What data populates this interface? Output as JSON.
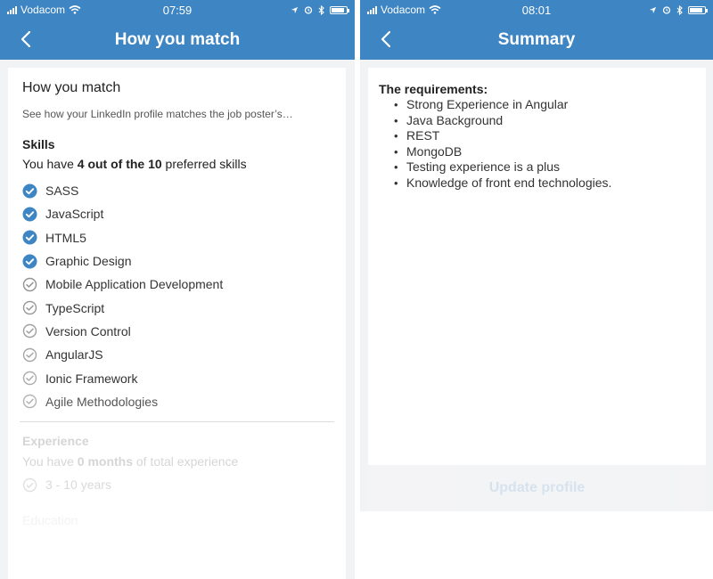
{
  "status_left": {
    "carrier": "Vodacom",
    "time": "07:59"
  },
  "status_right": {
    "carrier": "Vodacom",
    "time": "08:01"
  },
  "match_screen": {
    "title": "How you match",
    "card_title": "How you match",
    "card_subtitle": "See how your LinkedIn profile matches the job poster’s…",
    "skills": {
      "heading": "Skills",
      "summary_prefix": "You have ",
      "summary_bold": "4 out of the 10",
      "summary_suffix": " preferred skills",
      "items": [
        {
          "label": "SASS",
          "matched": true
        },
        {
          "label": "JavaScript",
          "matched": true
        },
        {
          "label": "HTML5",
          "matched": true
        },
        {
          "label": "Graphic Design",
          "matched": true
        },
        {
          "label": "Mobile Application Development",
          "matched": false
        },
        {
          "label": "TypeScript",
          "matched": false
        },
        {
          "label": "Version Control",
          "matched": false
        },
        {
          "label": "AngularJS",
          "matched": false
        },
        {
          "label": "Ionic Framework",
          "matched": false
        },
        {
          "label": "Agile Methodologies",
          "matched": false
        }
      ]
    },
    "experience": {
      "heading": "Experience",
      "summary_prefix": "You have ",
      "summary_bold": "0 months",
      "summary_suffix": " of total experience",
      "range": "3 - 10 years"
    },
    "education": {
      "heading": "Education"
    }
  },
  "summary_screen": {
    "title": "Summary",
    "requirements_heading": "The requirements:",
    "requirements": [
      "Strong Experience in Angular",
      "Java Background",
      "REST",
      "MongoDB",
      "Testing experience is a plus",
      "Knowledge of front end technologies."
    ],
    "update_button": "Update profile"
  },
  "colors": {
    "brand_blue": "#3d85c3",
    "matched_check": "#3d85c3",
    "unmatched_check": "#777777"
  },
  "icons": {
    "back": "chevron-left-icon",
    "matched": "filled-check-circle-icon",
    "unmatched": "outline-check-circle-icon"
  }
}
